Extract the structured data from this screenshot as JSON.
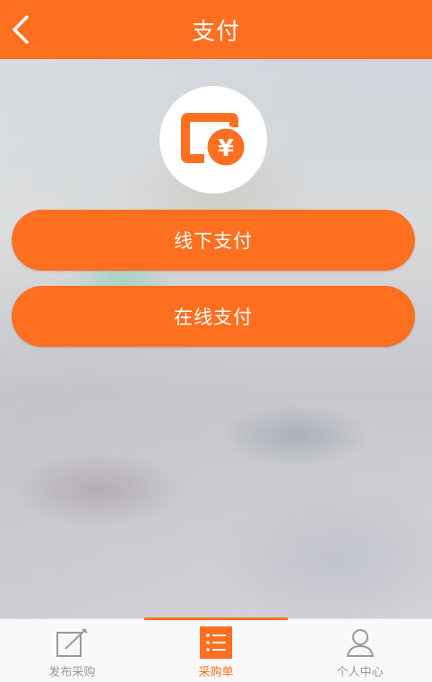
{
  "header": {
    "title": "支付",
    "back_icon": "chevron-left-icon"
  },
  "payment": {
    "icon": "wallet-yuan-icon",
    "icon_glyph": "¥",
    "options": [
      {
        "label": "线下支付"
      },
      {
        "label": "在线支付"
      }
    ]
  },
  "tabbar": {
    "items": [
      {
        "label": "发布采购",
        "icon": "edit-icon",
        "active": false
      },
      {
        "label": "采购单",
        "icon": "list-icon",
        "active": true
      },
      {
        "label": "个人中心",
        "icon": "user-icon",
        "active": false
      }
    ]
  },
  "colors": {
    "accent": "#ff6f20",
    "tab_inactive": "#9a9a9a",
    "tabbar_bg": "#f9f9f9"
  }
}
